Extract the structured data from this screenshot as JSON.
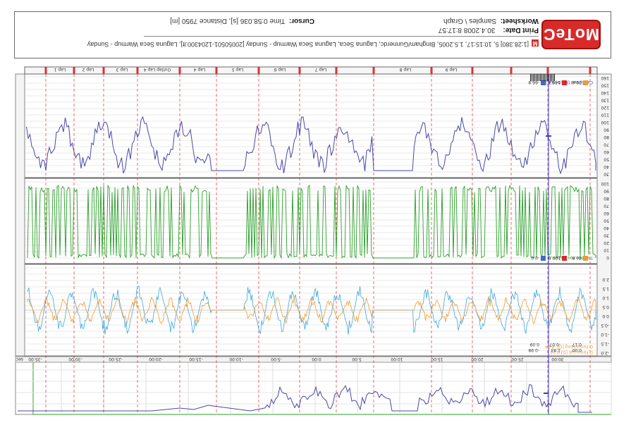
{
  "app": {
    "brand": "MoTeC"
  },
  "footer": {
    "session_line": "[1:28.380] 5, 10:15:17, 1.5.2005, Bingham/Gunnerdc, Laguna Seca, Laguna Seca Warmup - Sunday [20050501-1204300.lt], Laguna Seca Warmup - Sunday",
    "print_date_label": "Print Date:",
    "print_date_value": "30.4.2008 8:17:57",
    "worksheet_label": "Worksheet:",
    "worksheet_value": "Samples \\ Graph",
    "cursor_label": "Cursor:",
    "cursor_value": "Time 0:58.036 [s], Distance 7950 [m]"
  },
  "time_axis": {
    "unit": "sec",
    "ticks": [
      "-35:00",
      "-30:00",
      "-25:00",
      "-20:00",
      "-15:00",
      "-10:00",
      "-5:00",
      "0:00",
      "5:00",
      "10:00",
      "15:00",
      "20:00",
      "25:00",
      "30:00"
    ]
  },
  "lap_bar": {
    "laps": [
      "Lap 1",
      "Lap 2",
      "Lap 3",
      "Outlap Lap 4",
      "Lap 4",
      "Lap 5",
      "Lap 6",
      "Lap 7",
      "Lap 8",
      "Lap 9"
    ]
  },
  "panels": {
    "gforce": {
      "legend_lat": "G Force Lat [G]",
      "legend_long": "G Force Long [G]",
      "val_lat": "0.23",
      "val_long": "-0.04",
      "y_ticks": [
        "-2.0",
        "-1.5",
        "-1.0",
        "-0.5",
        "0.0",
        "0.5",
        "1.0",
        "1.5",
        "2.0"
      ],
      "cursor_vals": [
        "0.00",
        "1.93",
        "-0.98",
        "0.17",
        "-0.07",
        "0.09"
      ]
    },
    "throttle": {
      "legend": "Throttle Pos [%]",
      "value": "99.5",
      "y_ticks": [
        "100",
        "90",
        "80",
        "70",
        "60",
        "50",
        "40",
        "30",
        "20",
        "10",
        "0"
      ],
      "cursor_vals": [
        "40.6",
        "100.0",
        "-0.0"
      ]
    },
    "speed": {
      "legend": "Car Speed [km/h]",
      "value": "93.3",
      "y_ticks": [
        "160",
        "150",
        "140",
        "130",
        "120",
        "110",
        "100",
        "90",
        "80",
        "70",
        "60",
        "50",
        "40",
        "30"
      ],
      "cursor_vals": [
        "79.6",
        "146.4",
        "-66.8"
      ]
    }
  },
  "colors": {
    "speed": "#4848a8",
    "throttle": "#2aa02a",
    "g_lat": "#f39a2a",
    "g_long": "#3ea8e0",
    "marker": "#e03030",
    "cursor": "#3b3bd0"
  }
}
